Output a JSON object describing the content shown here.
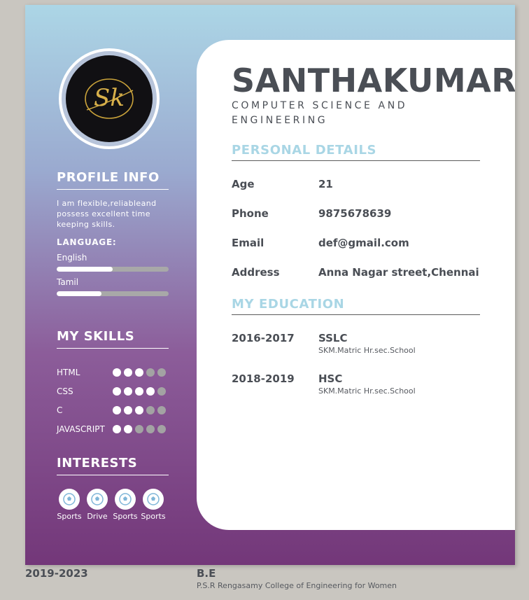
{
  "colors": {
    "gradient_top": "#acd6e6",
    "gradient_bottom": "#733779",
    "panel": "#ffffff",
    "heading_accent": "#a9d6e5",
    "text_dark": "#4a4e55",
    "dot_off": "#a3a3a3"
  },
  "avatar": {
    "monogram": "Sk",
    "icon": "monogram-logo"
  },
  "sidebar": {
    "profile_heading": "PROFILE INFO",
    "profile_text": "I am flexible,reliableand possess excellent time keeping skills.",
    "language_heading": "LANGUAGE:",
    "languages": [
      {
        "name": "English",
        "level": 0.5
      },
      {
        "name": "Tamil",
        "level": 0.4
      }
    ],
    "skills_heading": "MY SKILLS",
    "skills": [
      {
        "name": "HTML",
        "rating": 3,
        "max": 5
      },
      {
        "name": "CSS",
        "rating": 4,
        "max": 5
      },
      {
        "name": "C",
        "rating": 3,
        "max": 5
      },
      {
        "name": "JAVASCRIPT",
        "rating": 2,
        "max": 5
      }
    ],
    "interests_heading": "INTERESTS",
    "interests": [
      {
        "label": "Sports",
        "icon": "soccer-ball-icon"
      },
      {
        "label": "Drive",
        "icon": "soccer-ball-icon"
      },
      {
        "label": "Sports",
        "icon": "soccer-ball-icon"
      },
      {
        "label": "Sports",
        "icon": "soccer-ball-icon"
      }
    ]
  },
  "main": {
    "name": "SANTHAKUMARI",
    "department": "COMPUTER SCIENCE AND ENGINEERING",
    "personal_heading": "PERSONAL DETAILS",
    "personal": [
      {
        "label": "Age",
        "value": "21"
      },
      {
        "label": "Phone",
        "value": "9875678639"
      },
      {
        "label": "Email",
        "value": "def@gmail.com"
      },
      {
        "label": "Address",
        "value": "Anna Nagar street,Chennai"
      }
    ],
    "education_heading": "MY EDUCATION",
    "education": [
      {
        "year": "2016-2017",
        "degree": "SSLC",
        "school": "SKM.Matric Hr.sec.School"
      },
      {
        "year": "2018-2019",
        "degree": "HSC",
        "school": "SKM.Matric Hr.sec.School"
      },
      {
        "year": "2019-2023",
        "degree": "B.E",
        "school": "P.S.R Rengasamy College of Engineering for Women"
      }
    ]
  }
}
